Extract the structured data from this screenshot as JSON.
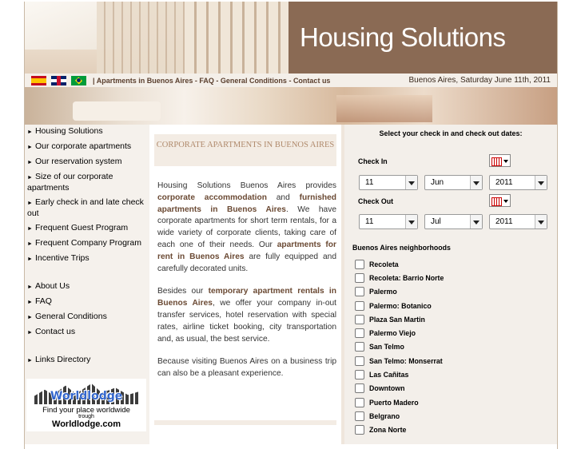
{
  "header": {
    "title": "Housing Solutions"
  },
  "nav": {
    "flags": [
      "spanish-flag-icon",
      "english-flag-icon",
      "portuguese-flag-icon"
    ],
    "separator": "|",
    "links": [
      {
        "label": "Apartments in Buenos Aires",
        "sep": " - "
      },
      {
        "label": "FAQ",
        "sep": " - "
      },
      {
        "label": "General Conditions",
        "sep": " - "
      },
      {
        "label": "Contact us",
        "sep": ""
      }
    ],
    "date": "Buenos Aires, Saturday June 11th, 2011"
  },
  "sidebar": {
    "arrow": "►",
    "group1": [
      "Housing Solutions",
      "Our corporate apartments",
      "Our reservation system",
      "Size of our corporate apartments",
      "Early check in and late check out",
      "Frequent Guest Program",
      "Frequent Company Program",
      "Incentive Trips"
    ],
    "group2": [
      "About Us",
      "FAQ",
      "General Conditions",
      "Contact us"
    ],
    "group3": [
      "Links Directory"
    ],
    "badge": {
      "logo": "Worldlodge",
      "line1": "Find your place worldwide",
      "line2": "trough",
      "line3": "Worldlodge.com"
    }
  },
  "content": {
    "heading": "CORPORATE APARTMENTS IN BUENOS AIRES",
    "p1": {
      "a": "Housing Solutions Buenos Aires provides ",
      "b": "corporate accommodation",
      "c": " and ",
      "d": "furnished apartments in Buenos Aires",
      "e": ". We have corporate apartments for short term rentals, for a wide variety of corporate clients, taking care of each one of their needs. Our ",
      "f": "apartments for rent in Buenos Aires",
      "g": " are fully equipped and carefully decorated units."
    },
    "p2": {
      "a": "Besides our ",
      "b": "temporary apartment rentals in Buenos Aires",
      "c": ", we offer your company in-out transfer services, hotel reservation with special rates, airline ticket booking, city transportation and, as usual, the best service."
    },
    "p3": "Because visiting Buenos Aires on a business trip can also be a pleasant experience."
  },
  "booking": {
    "title": "Select your check in and check out dates:",
    "checkin": {
      "label": "Check In",
      "day": "11",
      "month": "Jun",
      "year": "2011"
    },
    "checkout": {
      "label": "Check Out",
      "day": "11",
      "month": "Jul",
      "year": "2011"
    },
    "neighborhoods_title": "Buenos Aires neighborhoods",
    "neighborhoods": [
      "Recoleta",
      "Recoleta: Barrio Norte",
      "Palermo",
      "Palermo: Botanico",
      "Plaza San Martin",
      "Palermo Viejo",
      "San Telmo",
      "San Telmo: Monserrat",
      "Las Cañitas",
      "Downtown",
      "Puerto Madero",
      "Belgrano",
      "Zona Norte"
    ]
  }
}
